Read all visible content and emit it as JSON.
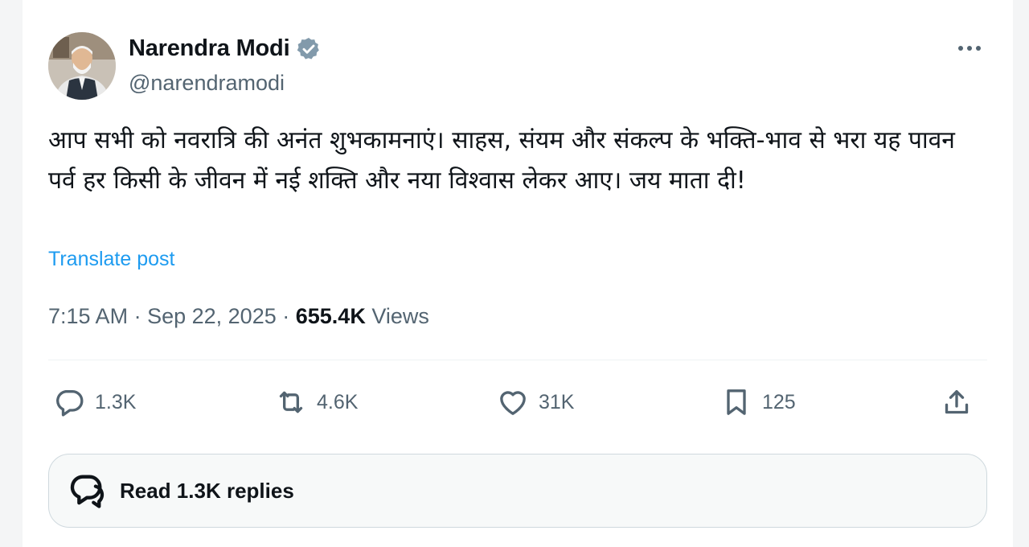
{
  "author": {
    "name": "Narendra Modi",
    "handle": "@narendramodi",
    "verified_color": "#829aab"
  },
  "tweet": {
    "text": "आप सभी को नवरात्रि की अनंत शुभकामनाएं। साहस, संयम और संकल्प के भक्ति-भाव से भरा यह पावन पर्व हर किसी के जीवन में नई शक्ति और नया विश्वास लेकर आए। जय माता दी!",
    "translate_label": "Translate post",
    "time": "7:15 AM",
    "date": "Sep 22, 2025",
    "views_count": "655.4K",
    "views_label": "Views"
  },
  "actions": {
    "replies": "1.3K",
    "reposts": "4.6K",
    "likes": "31K",
    "bookmarks": "125"
  },
  "read_replies_label": "Read 1.3K replies",
  "icons": {
    "reply": "speech-bubble-icon",
    "repost": "repost-arrows-icon",
    "like": "heart-icon",
    "bookmark": "bookmark-icon",
    "share": "share-upload-icon",
    "more": "more-dots-icon",
    "verified": "verified-badge-icon",
    "replies_button": "conversation-bubbles-icon"
  },
  "colors": {
    "link": "#1d9bf0",
    "secondary_text": "#536471",
    "primary_text": "#0f1419"
  }
}
